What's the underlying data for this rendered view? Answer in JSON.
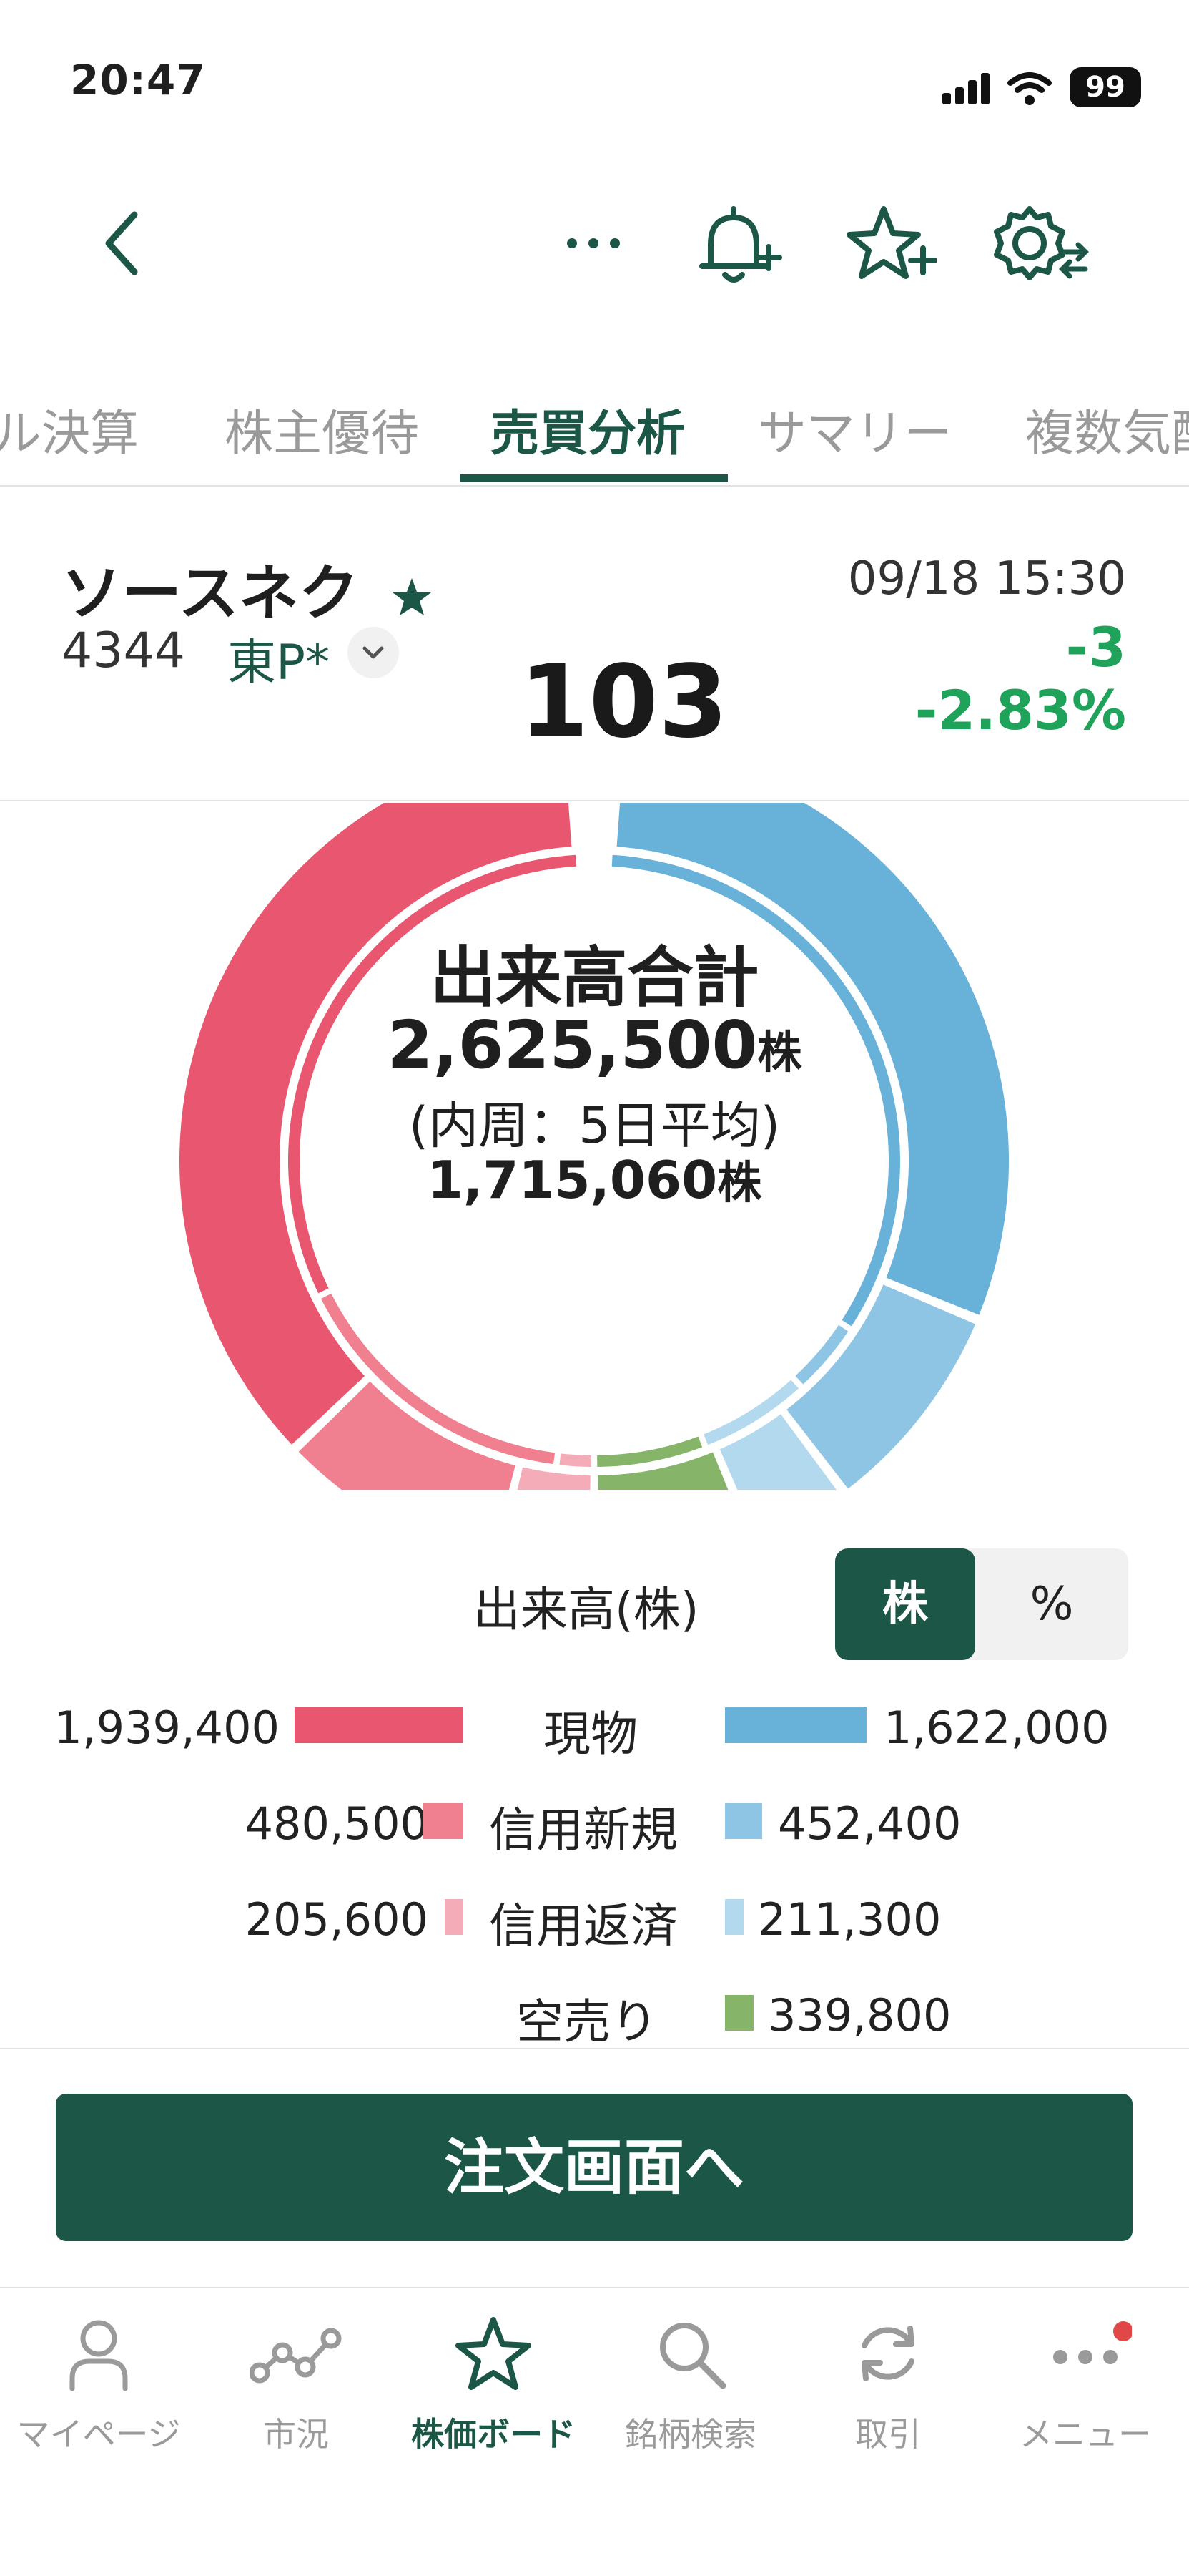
{
  "status_bar": {
    "time": "20:47",
    "battery": "99"
  },
  "tabs": [
    {
      "label": "ル決算",
      "active": false
    },
    {
      "label": "株主優待",
      "active": false
    },
    {
      "label": "売買分析",
      "active": true
    },
    {
      "label": "サマリー",
      "active": false
    },
    {
      "label": "複数気配",
      "active": false
    }
  ],
  "stock": {
    "name": "ソースネク",
    "code": "4344",
    "market": "東P*",
    "datetime": "09/18 15:30",
    "price": "103",
    "change": "-3",
    "change_pct": "-2.83%"
  },
  "donut": {
    "title": "出来高合計",
    "total": "2,625,500",
    "unit": "株",
    "subtitle": "(内周：5日平均)",
    "avg": "1,715,060",
    "colors": {
      "buy_spot": "#e8566f",
      "buy_margin_new": "#f0808f",
      "buy_margin_repay": "#f4adb8",
      "sell_spot": "#68b1d9",
      "sell_margin_new": "#8ec5e4",
      "sell_margin_repay": "#b3d9ee",
      "short_sell": "#86b56a"
    }
  },
  "volume": {
    "title": "出来高(株)",
    "toggle": {
      "share_label": "株",
      "percent_label": "%",
      "selected": "株"
    },
    "rows": [
      {
        "label": "現物",
        "left": "1,939,400",
        "right": "1,622,000"
      },
      {
        "label": "信用新規",
        "left": "480,500",
        "right": "452,400"
      },
      {
        "label": "信用返済",
        "left": "205,600",
        "right": "211,300"
      },
      {
        "label": "空売り",
        "left": "",
        "right": "339,800"
      }
    ]
  },
  "order_button": "注文画面へ",
  "tabbar": [
    {
      "label": "マイページ",
      "icon": "person-icon",
      "active": false
    },
    {
      "label": "市況",
      "icon": "market-icon",
      "active": false
    },
    {
      "label": "株価ボード",
      "icon": "star-icon",
      "active": true
    },
    {
      "label": "銘柄検索",
      "icon": "search-icon",
      "active": false
    },
    {
      "label": "取引",
      "icon": "refresh-icon",
      "active": false
    },
    {
      "label": "メニュー",
      "icon": "more-icon",
      "active": false
    }
  ]
}
